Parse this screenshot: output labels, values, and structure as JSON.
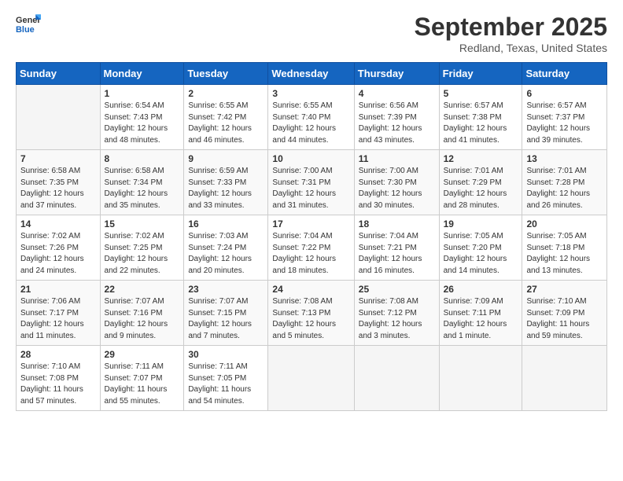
{
  "header": {
    "logo_line1": "General",
    "logo_line2": "Blue",
    "month_title": "September 2025",
    "location": "Redland, Texas, United States"
  },
  "weekdays": [
    "Sunday",
    "Monday",
    "Tuesday",
    "Wednesday",
    "Thursday",
    "Friday",
    "Saturday"
  ],
  "weeks": [
    [
      {
        "day": "",
        "sunrise": "",
        "sunset": "",
        "daylight": ""
      },
      {
        "day": "1",
        "sunrise": "Sunrise: 6:54 AM",
        "sunset": "Sunset: 7:43 PM",
        "daylight": "Daylight: 12 hours and 48 minutes."
      },
      {
        "day": "2",
        "sunrise": "Sunrise: 6:55 AM",
        "sunset": "Sunset: 7:42 PM",
        "daylight": "Daylight: 12 hours and 46 minutes."
      },
      {
        "day": "3",
        "sunrise": "Sunrise: 6:55 AM",
        "sunset": "Sunset: 7:40 PM",
        "daylight": "Daylight: 12 hours and 44 minutes."
      },
      {
        "day": "4",
        "sunrise": "Sunrise: 6:56 AM",
        "sunset": "Sunset: 7:39 PM",
        "daylight": "Daylight: 12 hours and 43 minutes."
      },
      {
        "day": "5",
        "sunrise": "Sunrise: 6:57 AM",
        "sunset": "Sunset: 7:38 PM",
        "daylight": "Daylight: 12 hours and 41 minutes."
      },
      {
        "day": "6",
        "sunrise": "Sunrise: 6:57 AM",
        "sunset": "Sunset: 7:37 PM",
        "daylight": "Daylight: 12 hours and 39 minutes."
      }
    ],
    [
      {
        "day": "7",
        "sunrise": "Sunrise: 6:58 AM",
        "sunset": "Sunset: 7:35 PM",
        "daylight": "Daylight: 12 hours and 37 minutes."
      },
      {
        "day": "8",
        "sunrise": "Sunrise: 6:58 AM",
        "sunset": "Sunset: 7:34 PM",
        "daylight": "Daylight: 12 hours and 35 minutes."
      },
      {
        "day": "9",
        "sunrise": "Sunrise: 6:59 AM",
        "sunset": "Sunset: 7:33 PM",
        "daylight": "Daylight: 12 hours and 33 minutes."
      },
      {
        "day": "10",
        "sunrise": "Sunrise: 7:00 AM",
        "sunset": "Sunset: 7:31 PM",
        "daylight": "Daylight: 12 hours and 31 minutes."
      },
      {
        "day": "11",
        "sunrise": "Sunrise: 7:00 AM",
        "sunset": "Sunset: 7:30 PM",
        "daylight": "Daylight: 12 hours and 30 minutes."
      },
      {
        "day": "12",
        "sunrise": "Sunrise: 7:01 AM",
        "sunset": "Sunset: 7:29 PM",
        "daylight": "Daylight: 12 hours and 28 minutes."
      },
      {
        "day": "13",
        "sunrise": "Sunrise: 7:01 AM",
        "sunset": "Sunset: 7:28 PM",
        "daylight": "Daylight: 12 hours and 26 minutes."
      }
    ],
    [
      {
        "day": "14",
        "sunrise": "Sunrise: 7:02 AM",
        "sunset": "Sunset: 7:26 PM",
        "daylight": "Daylight: 12 hours and 24 minutes."
      },
      {
        "day": "15",
        "sunrise": "Sunrise: 7:02 AM",
        "sunset": "Sunset: 7:25 PM",
        "daylight": "Daylight: 12 hours and 22 minutes."
      },
      {
        "day": "16",
        "sunrise": "Sunrise: 7:03 AM",
        "sunset": "Sunset: 7:24 PM",
        "daylight": "Daylight: 12 hours and 20 minutes."
      },
      {
        "day": "17",
        "sunrise": "Sunrise: 7:04 AM",
        "sunset": "Sunset: 7:22 PM",
        "daylight": "Daylight: 12 hours and 18 minutes."
      },
      {
        "day": "18",
        "sunrise": "Sunrise: 7:04 AM",
        "sunset": "Sunset: 7:21 PM",
        "daylight": "Daylight: 12 hours and 16 minutes."
      },
      {
        "day": "19",
        "sunrise": "Sunrise: 7:05 AM",
        "sunset": "Sunset: 7:20 PM",
        "daylight": "Daylight: 12 hours and 14 minutes."
      },
      {
        "day": "20",
        "sunrise": "Sunrise: 7:05 AM",
        "sunset": "Sunset: 7:18 PM",
        "daylight": "Daylight: 12 hours and 13 minutes."
      }
    ],
    [
      {
        "day": "21",
        "sunrise": "Sunrise: 7:06 AM",
        "sunset": "Sunset: 7:17 PM",
        "daylight": "Daylight: 12 hours and 11 minutes."
      },
      {
        "day": "22",
        "sunrise": "Sunrise: 7:07 AM",
        "sunset": "Sunset: 7:16 PM",
        "daylight": "Daylight: 12 hours and 9 minutes."
      },
      {
        "day": "23",
        "sunrise": "Sunrise: 7:07 AM",
        "sunset": "Sunset: 7:15 PM",
        "daylight": "Daylight: 12 hours and 7 minutes."
      },
      {
        "day": "24",
        "sunrise": "Sunrise: 7:08 AM",
        "sunset": "Sunset: 7:13 PM",
        "daylight": "Daylight: 12 hours and 5 minutes."
      },
      {
        "day": "25",
        "sunrise": "Sunrise: 7:08 AM",
        "sunset": "Sunset: 7:12 PM",
        "daylight": "Daylight: 12 hours and 3 minutes."
      },
      {
        "day": "26",
        "sunrise": "Sunrise: 7:09 AM",
        "sunset": "Sunset: 7:11 PM",
        "daylight": "Daylight: 12 hours and 1 minute."
      },
      {
        "day": "27",
        "sunrise": "Sunrise: 7:10 AM",
        "sunset": "Sunset: 7:09 PM",
        "daylight": "Daylight: 11 hours and 59 minutes."
      }
    ],
    [
      {
        "day": "28",
        "sunrise": "Sunrise: 7:10 AM",
        "sunset": "Sunset: 7:08 PM",
        "daylight": "Daylight: 11 hours and 57 minutes."
      },
      {
        "day": "29",
        "sunrise": "Sunrise: 7:11 AM",
        "sunset": "Sunset: 7:07 PM",
        "daylight": "Daylight: 11 hours and 55 minutes."
      },
      {
        "day": "30",
        "sunrise": "Sunrise: 7:11 AM",
        "sunset": "Sunset: 7:05 PM",
        "daylight": "Daylight: 11 hours and 54 minutes."
      },
      {
        "day": "",
        "sunrise": "",
        "sunset": "",
        "daylight": ""
      },
      {
        "day": "",
        "sunrise": "",
        "sunset": "",
        "daylight": ""
      },
      {
        "day": "",
        "sunrise": "",
        "sunset": "",
        "daylight": ""
      },
      {
        "day": "",
        "sunrise": "",
        "sunset": "",
        "daylight": ""
      }
    ]
  ]
}
